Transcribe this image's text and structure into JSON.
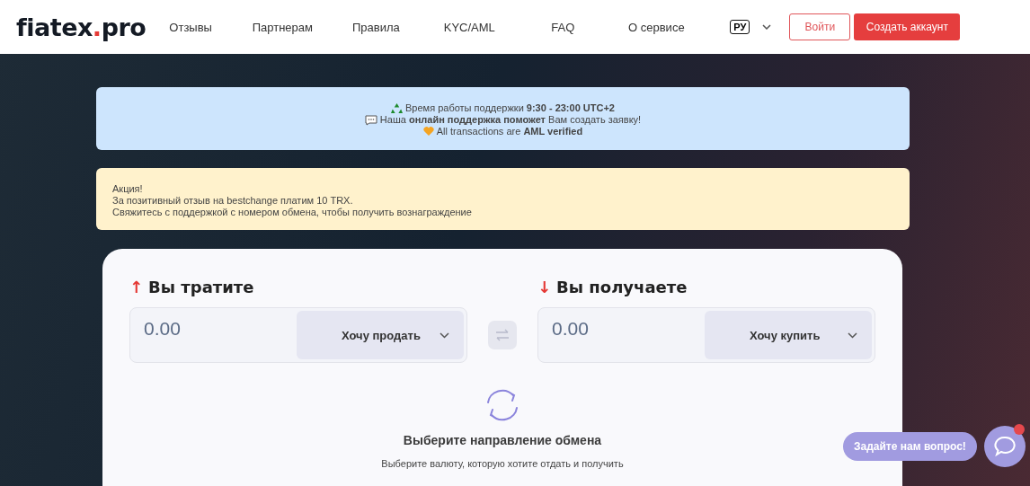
{
  "header": {
    "logo": {
      "left": "fiatex",
      "dot": ".",
      "right": "pro"
    },
    "nav": [
      "Отзывы",
      "Партнерам",
      "Правила",
      "KYC/AML",
      "FAQ",
      "О сервисе"
    ],
    "language": "РУ",
    "login": "Войти",
    "signup": "Создать аккаунт"
  },
  "support_notice": {
    "lines": [
      "Время работы поддержки **9:30 - 23:00 UTC+2**",
      "Наша **онлайн поддержка поможет** Вам создать заявку!",
      "All transactions are **AML verified**"
    ]
  },
  "promo_notice": {
    "lines": [
      "Акция!",
      "За позитивный отзыв на bestchange платим 10 TRX.",
      "Свяжитесь с поддержкой с номером обмена, чтобы получить вознаграждение"
    ]
  },
  "exchange": {
    "give": {
      "arrow": "↑",
      "title": "Вы тратите",
      "amount_placeholder": "0.00",
      "currency": "Хочу продать"
    },
    "receive": {
      "arrow": "↓",
      "title": "Вы получаете",
      "amount_placeholder": "0.00",
      "currency": "Хочу купить"
    },
    "empty_title": "Выберите направление обмена",
    "empty_text": "Выберите валюту, которую хотите отдать и получить"
  },
  "chat": {
    "prompt": "Задайте нам вопрос!",
    "unread": true
  }
}
